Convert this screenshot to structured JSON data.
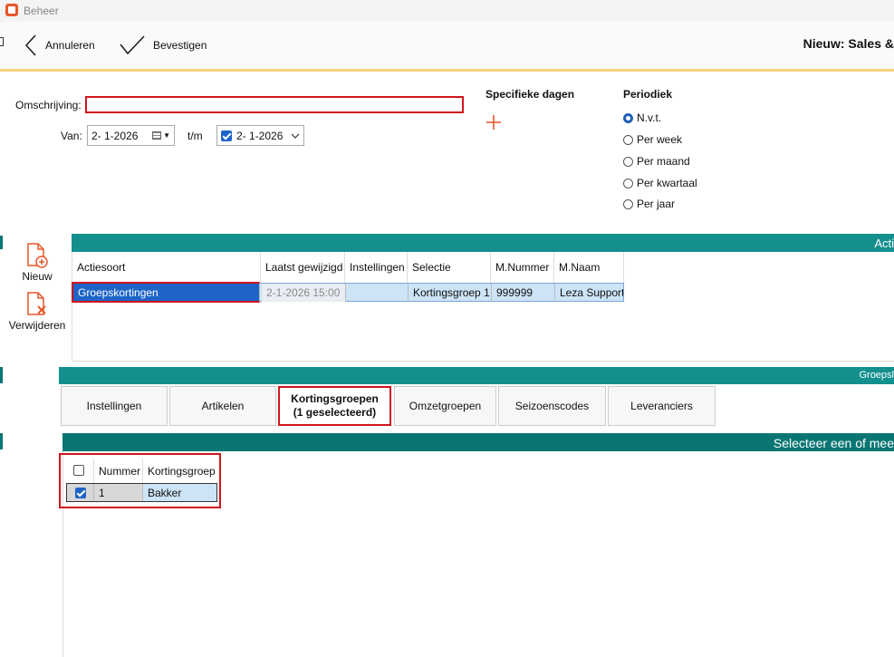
{
  "window": {
    "title": "Beheer"
  },
  "toolbar": {
    "cancel_label": "Annuleren",
    "confirm_label": "Bevestigen",
    "page_heading": "Nieuw: Sales &"
  },
  "form": {
    "description_label": "Omschrijving:",
    "description_value": "",
    "from_label": "Van:",
    "from_date": "2-  1-2026",
    "until_label": "t/m",
    "until_date": "2-  1-2026",
    "specific_days_label": "Specifieke dagen",
    "periodic_label": "Periodiek",
    "periodic_options": [
      "N.v.t.",
      "Per week",
      "Per maand",
      "Per kwartaal",
      "Per jaar"
    ],
    "periodic_selected": "N.v.t."
  },
  "side_actions": {
    "new_label": "Nieuw",
    "delete_label": "Verwijderen"
  },
  "actions_section": {
    "header": "Acti",
    "columns": [
      "Actiesoort",
      "Laatst gewijzigd",
      "Instellingen",
      "Selectie",
      "M.Nummer",
      "M.Naam"
    ],
    "rows": [
      {
        "actiesoort": "Groepskortingen",
        "laatst_gewijzigd": "2-1-2026 15:00",
        "instellingen": "",
        "selectie": "Kortingsgroep 1",
        "m_nummer": "999999",
        "m_naam": "Leza Support"
      }
    ]
  },
  "group_section": {
    "header": "Groepsl"
  },
  "tabs": [
    {
      "label": "Instellingen"
    },
    {
      "label": "Artikelen"
    },
    {
      "label": "Kortingsgroepen",
      "sublabel": "(1 geselecteerd)"
    },
    {
      "label": "Omzetgroepen"
    },
    {
      "label": "Seizoenscodes"
    },
    {
      "label": "Leveranciers"
    }
  ],
  "select_section": {
    "header": "Selecteer een of mee",
    "columns": [
      "Nummer",
      "Kortingsgroep"
    ],
    "rows": [
      {
        "checked": true,
        "nummer": "1",
        "kortingsgroep": "Bakker"
      }
    ]
  },
  "colors": {
    "teal": "#13908e",
    "teal_dark": "#0a7674",
    "highlight_red": "#d0141c",
    "accent_orange": "#e8572a",
    "selection_blue": "#1e64c8"
  }
}
